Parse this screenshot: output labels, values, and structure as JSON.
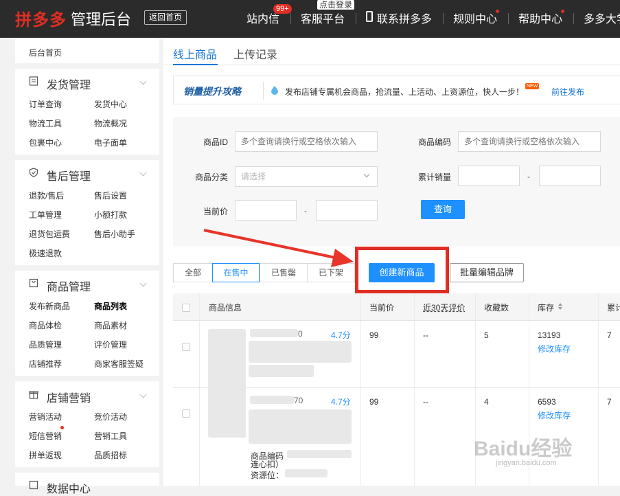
{
  "topbar": {
    "logo_red": "拼多多",
    "logo_white": "管理后台",
    "back_home": "返回首页",
    "nav": [
      "站内信",
      "客服平台",
      "联系拼多多",
      "规则中心",
      "帮助中心",
      "多多大学"
    ],
    "badge": "99+",
    "login_tip": "点击登录"
  },
  "sidebar": {
    "home": "后台首页",
    "sections": [
      {
        "title": "发货管理",
        "icon": "document-icon",
        "items": [
          "订单查询",
          "发货中心",
          "物流工具",
          "物流概况",
          "包裹中心",
          "电子面单"
        ]
      },
      {
        "title": "售后管理",
        "icon": "shield-icon",
        "items": [
          "退款/售后",
          "售后设置",
          "工单管理",
          "小额打款",
          "退货包运费",
          "售后小助手",
          "极速退款"
        ]
      },
      {
        "title": "商品管理",
        "icon": "bag-icon",
        "items": [
          "发布新商品",
          "商品列表",
          "商品体检",
          "商品素材",
          "品质管理",
          "评价管理",
          "店铺推荐",
          "商家客服签疑"
        ]
      },
      {
        "title": "店铺营销",
        "icon": "gift-icon",
        "items": [
          "营销活动",
          "竞价活动",
          "短信营销",
          "营销工具",
          "拼单返现",
          "品质招标"
        ]
      },
      {
        "title": "数据中心",
        "icon": "chart-icon",
        "items": []
      }
    ]
  },
  "tabs": {
    "online": "线上商品",
    "upload": "上传记录"
  },
  "promo": {
    "title": "销量提升攻略",
    "text": "发布店铺专属机会商品，抢流量、上活动、上资源位，快人一步！",
    "new_badge": "NEW",
    "link": "前往发布"
  },
  "filter": {
    "id_label": "商品ID",
    "id_placeholder": "多个查询请换行或空格依次输入",
    "code_label": "商品编码",
    "code_placeholder": "多个查询请换行或空格依次输入",
    "category_label": "商品分类",
    "category_placeholder": "请选择",
    "sales_label": "累计销量",
    "price_label": "当前价",
    "dash": "-",
    "query_button": "查询"
  },
  "status_tabs": [
    "全部",
    "在售中",
    "已售罄",
    "已下架"
  ],
  "actions": {
    "create": "创建新商品",
    "batch_brand": "批量编辑品牌"
  },
  "table": {
    "headers": [
      "商品信息",
      "当前价",
      "近30天评价",
      "收藏数",
      "库存",
      "累计"
    ],
    "rows": [
      {
        "score": "4.7分",
        "id_tail": "0",
        "price": "99",
        "reviews": "--",
        "favorites": "5",
        "stock": "13193",
        "edit_stock": "修改库存",
        "sales": "7"
      },
      {
        "score": "4.7分",
        "id_tail": "70",
        "price": "99",
        "reviews": "--",
        "favorites": "4",
        "stock": "6593",
        "edit_stock": "修改库存",
        "sales": "7",
        "code_label": "商品编码",
        "extra_line": "连心扣）",
        "resource_label": "资源位："
      }
    ]
  },
  "watermark": {
    "text": "Baidu经验",
    "sub": "jingyan.baidu.com"
  }
}
